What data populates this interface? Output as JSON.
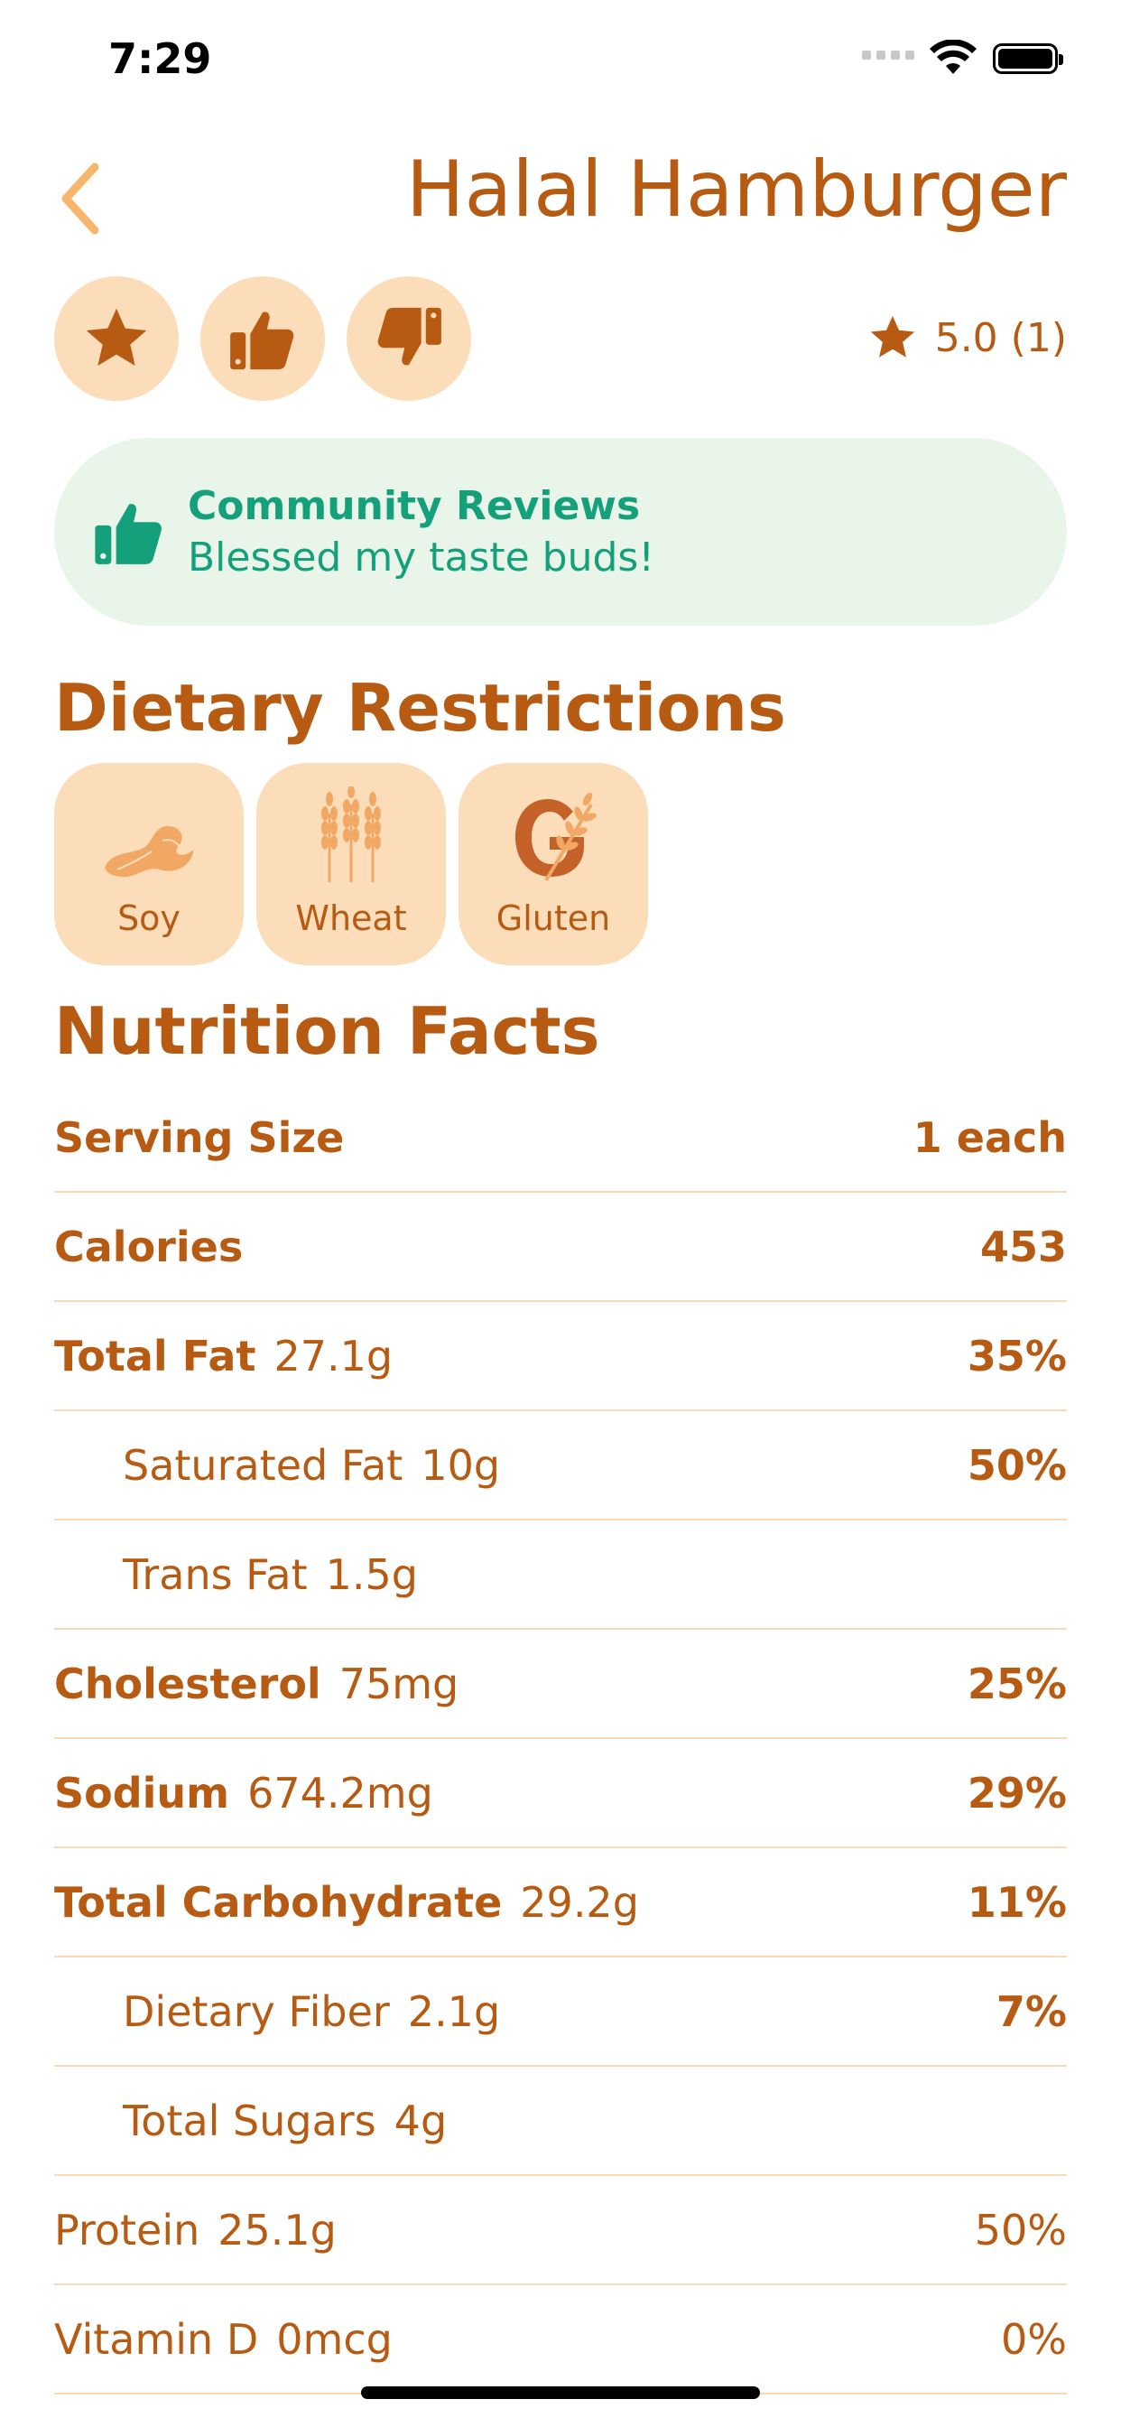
{
  "status_bar": {
    "time": "7:29"
  },
  "header": {
    "title": "Halal Hamburger"
  },
  "rating": {
    "text": "5.0 (1)"
  },
  "community_reviews": {
    "title": "Community Reviews",
    "summary": "Blessed my taste buds!"
  },
  "dietary": {
    "heading": "Dietary Restrictions",
    "items": [
      {
        "label": "Soy",
        "icon": "soy-icon"
      },
      {
        "label": "Wheat",
        "icon": "wheat-icon"
      },
      {
        "label": "Gluten",
        "icon": "gluten-icon"
      }
    ]
  },
  "nutrition": {
    "heading": "Nutrition Facts",
    "rows": [
      {
        "label": "Serving Size",
        "amount": "",
        "value": "1 each"
      },
      {
        "label": "Calories",
        "amount": "",
        "value": "453"
      },
      {
        "label": "Total Fat",
        "amount": "27.1g",
        "value": "35%"
      },
      {
        "label": "Saturated Fat",
        "amount": "10g",
        "value": "50%"
      },
      {
        "label": "Trans Fat",
        "amount": "1.5g",
        "value": ""
      },
      {
        "label": "Cholesterol",
        "amount": "75mg",
        "value": "25%"
      },
      {
        "label": "Sodium",
        "amount": "674.2mg",
        "value": "29%"
      },
      {
        "label": "Total Carbohydrate",
        "amount": "29.2g",
        "value": "11%"
      },
      {
        "label": "Dietary Fiber",
        "amount": "2.1g",
        "value": "7%"
      },
      {
        "label": "Total Sugars",
        "amount": "4g",
        "value": ""
      },
      {
        "label": "Protein",
        "amount": "25.1g",
        "value": "50%"
      },
      {
        "label": "Vitamin D",
        "amount": "0mcg",
        "value": "0%"
      }
    ]
  },
  "colors": {
    "accent": "#B75A12",
    "chip_bg": "#FCDDBA",
    "review_bg": "#EAF5E9",
    "review_text": "#14A07A",
    "divider": "#F8D9B8"
  }
}
